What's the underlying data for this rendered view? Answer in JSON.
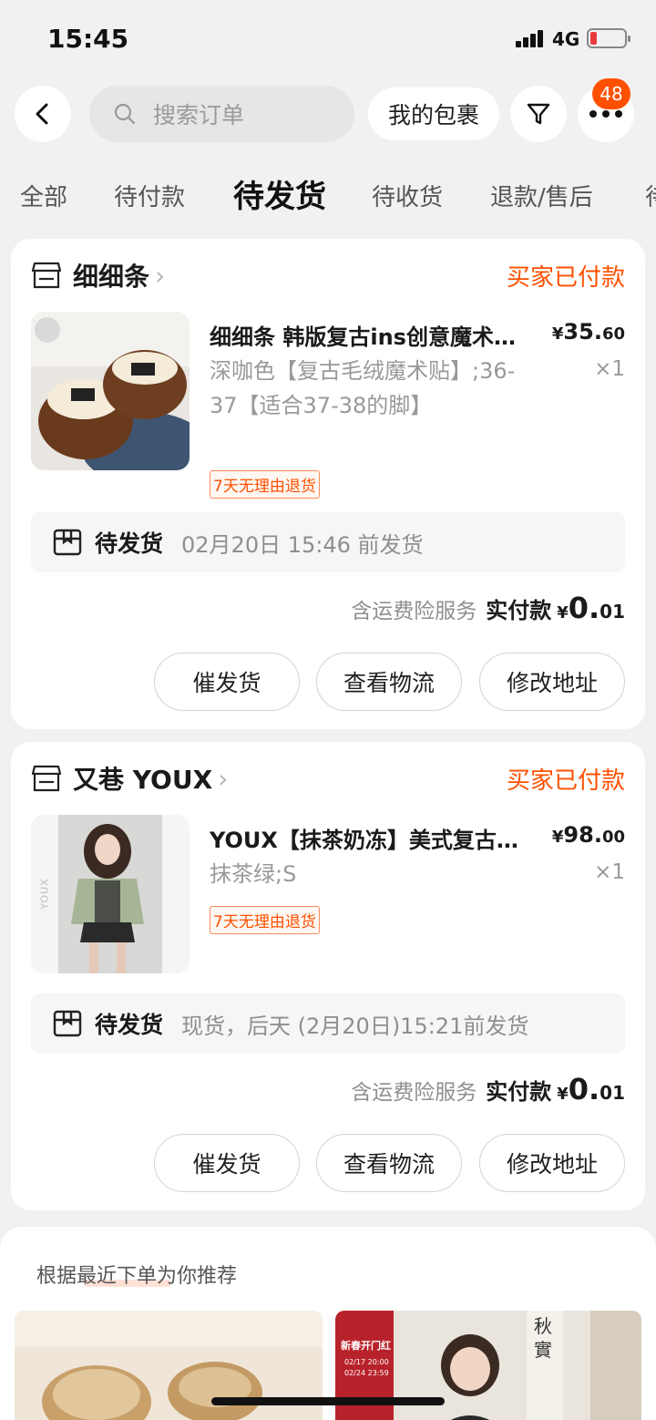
{
  "status_bar": {
    "time": "15:45",
    "network": "4G",
    "battery_level": 0.2
  },
  "top_bar": {
    "search_placeholder": "搜索订单",
    "my_packages": "我的包裹",
    "badge_count": "48"
  },
  "tabs": [
    "全部",
    "待付款",
    "待发货",
    "待收货",
    "退款/售后",
    "待"
  ],
  "active_tab": "待发货",
  "orders": [
    {
      "shop": "细细条",
      "status": "买家已付款",
      "title": "细细条 韩版复古ins创意魔术贴毛绒拖鞋",
      "price_yen": "¥",
      "price_int": "35.",
      "price_dec": "60",
      "sku": "深咖色【复古毛绒魔术贴】;36-37【适合37-38的脚】",
      "qty": "×1",
      "tag": "7天无理由退货",
      "ship_status": "待发货",
      "ship_time": "02月20日 15:46 前发货",
      "insurance": "含运费险服务",
      "paid_label": "实付款",
      "paid_yen": "¥",
      "paid_int": "0.",
      "paid_dec": "01",
      "buttons": [
        "催发货",
        "查看物流",
        "修改地址"
      ]
    },
    {
      "shop": "又巷 YOUX",
      "status": "买家已付款",
      "title": "YOUX【抹茶奶冻】美式复古短款外套",
      "price_yen": "¥",
      "price_int": "98.",
      "price_dec": "00",
      "sku": "抹茶绿;S",
      "qty": "×1",
      "tag": "7天无理由退货",
      "ship_status": "待发货",
      "ship_time": "现货，后天 (2月20日)15:21前发货",
      "insurance": "含运费险服务",
      "paid_label": "实付款",
      "paid_yen": "¥",
      "paid_int": "0.",
      "paid_dec": "01",
      "buttons": [
        "催发货",
        "查看物流",
        "修改地址"
      ],
      "thumb_watermark": "YOUX"
    }
  ],
  "recommend": {
    "title": "根据最近下单为你推荐",
    "promo_text": "新春开门红",
    "promo_dates": [
      "02/17 20:00",
      "02/24 23:59"
    ],
    "sign_text": "秋實"
  },
  "colors": {
    "accent": "#ff5000",
    "background": "#f1f1f3"
  }
}
